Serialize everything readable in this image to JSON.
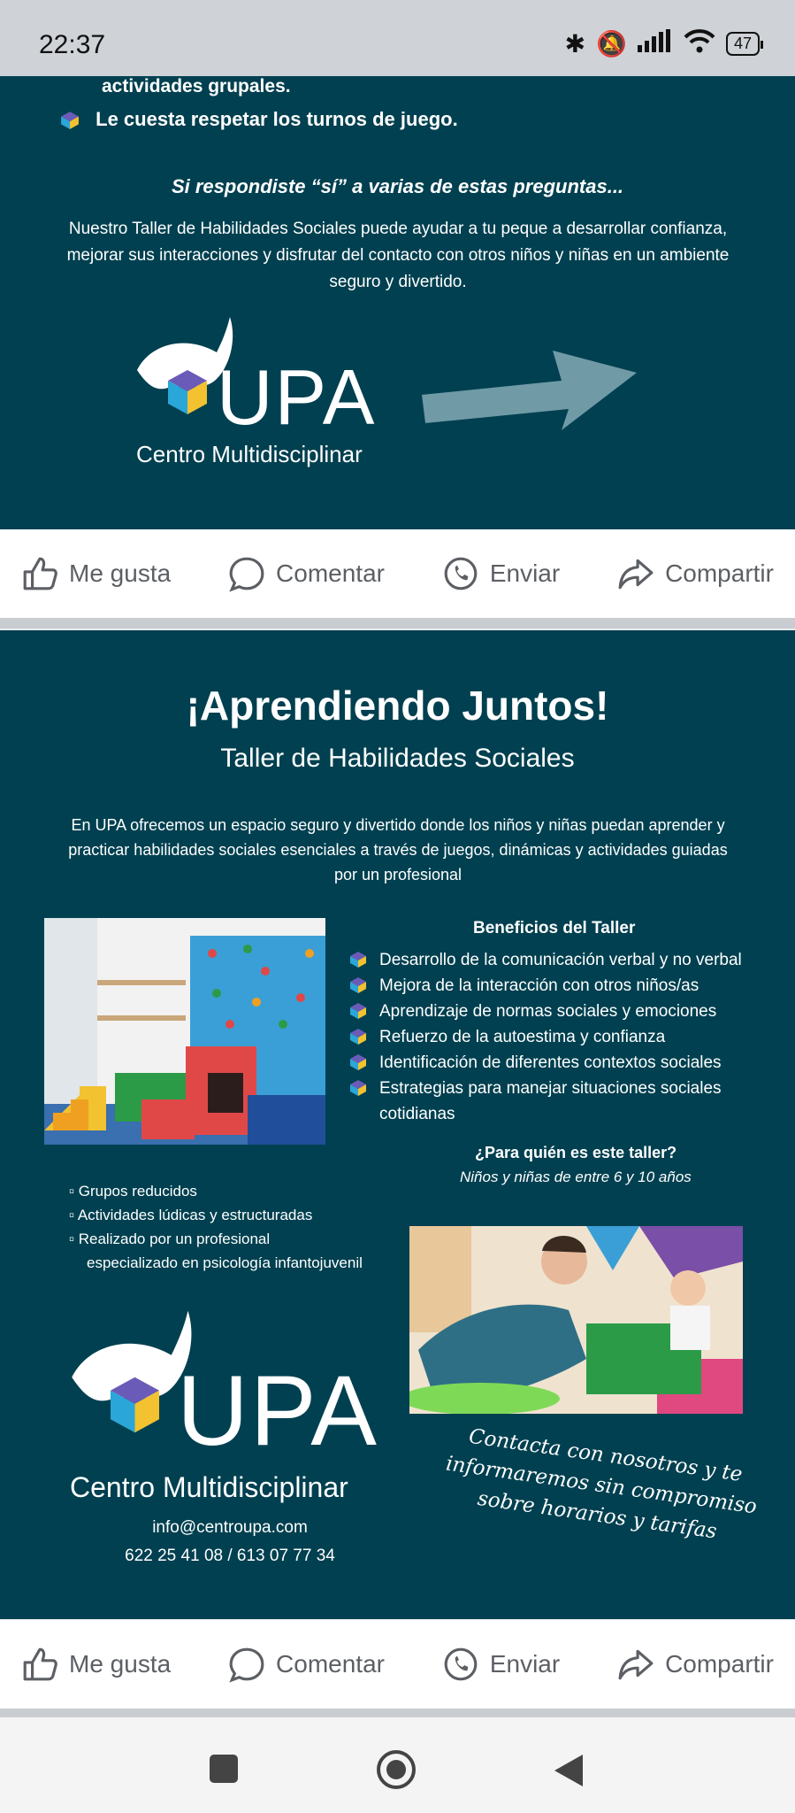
{
  "status": {
    "time": "22:37",
    "battery": "47"
  },
  "post1": {
    "partial_line": "actividades grupales.",
    "bullet_item": "Le cuesta respetar los turnos de juego.",
    "question": "Si respondiste “sí” a varias de estas preguntas...",
    "description": "Nuestro Taller de Habilidades Sociales puede ayudar a tu peque a desarrollar confianza, mejorar sus interacciones y disfrutar del contacto con otros niños y niñas en un ambiente seguro y divertido.",
    "logo_text": "UPA",
    "logo_sub": "Centro Multidisciplinar"
  },
  "actions": {
    "like": "Me gusta",
    "comment": "Comentar",
    "send": "Enviar",
    "share": "Compartir"
  },
  "post2": {
    "title": "¡Aprendiendo Juntos!",
    "subtitle": "Taller de Habilidades Sociales",
    "description": "En UPA ofrecemos un espacio seguro y divertido donde los niños y niñas puedan aprender y practicar habilidades sociales esenciales a través de juegos, dinámicas y actividades guiadas por un profesional",
    "benefits_title": "Beneficios del Taller",
    "benefits": [
      "Desarrollo de la comunicación verbal y no verbal",
      "Mejora de la interacción con otros niños/as",
      "Aprendizaje de normas sociales y emociones",
      "Refuerzo de la autoestima y confianza",
      "Identificación de diferentes contextos sociales",
      "Estrategias para manejar situaciones sociales cotidianas"
    ],
    "para_title": "¿Para quién es este taller?",
    "para_sub": "Niños y niñas de entre 6 y 10 años",
    "features": [
      "Grupos reducidos",
      "Actividades lúdicas y estructuradas",
      "Realizado por un profesional",
      "especializado en psicología infantojuvenil"
    ],
    "logo_text": "UPA",
    "logo_sub": "Centro Multidisciplinar",
    "email": "info@centroupa.com",
    "phones": "622 25 41 08 / 613 07 77 34",
    "script_text": "Contacta con nosotros y te informaremos sin compromiso sobre horarios y tarifas"
  },
  "colors": {
    "post_bg": "#004050",
    "arrow": "#6f9aa6"
  }
}
